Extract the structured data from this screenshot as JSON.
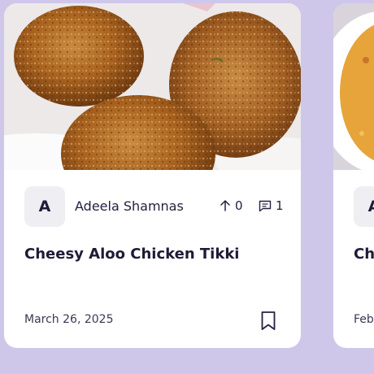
{
  "cards": [
    {
      "author": {
        "initial": "A",
        "name": "Adeela Shamnas"
      },
      "stats": {
        "upvotes": "0",
        "comments": "1"
      },
      "title": "Cheesy Aloo Chicken Tikki",
      "date": "March 26, 2025"
    },
    {
      "author": {
        "initial": "A"
      },
      "title": "Ch",
      "date": "Feb"
    }
  ],
  "icons": {
    "upvote": "arrow-up-icon",
    "comments": "comment-icon",
    "bookmark": "bookmark-icon"
  },
  "colors": {
    "background": "#cfc7ea",
    "card": "#ffffff",
    "text": "#1f1b36",
    "avatar_bg": "#efeef2"
  }
}
